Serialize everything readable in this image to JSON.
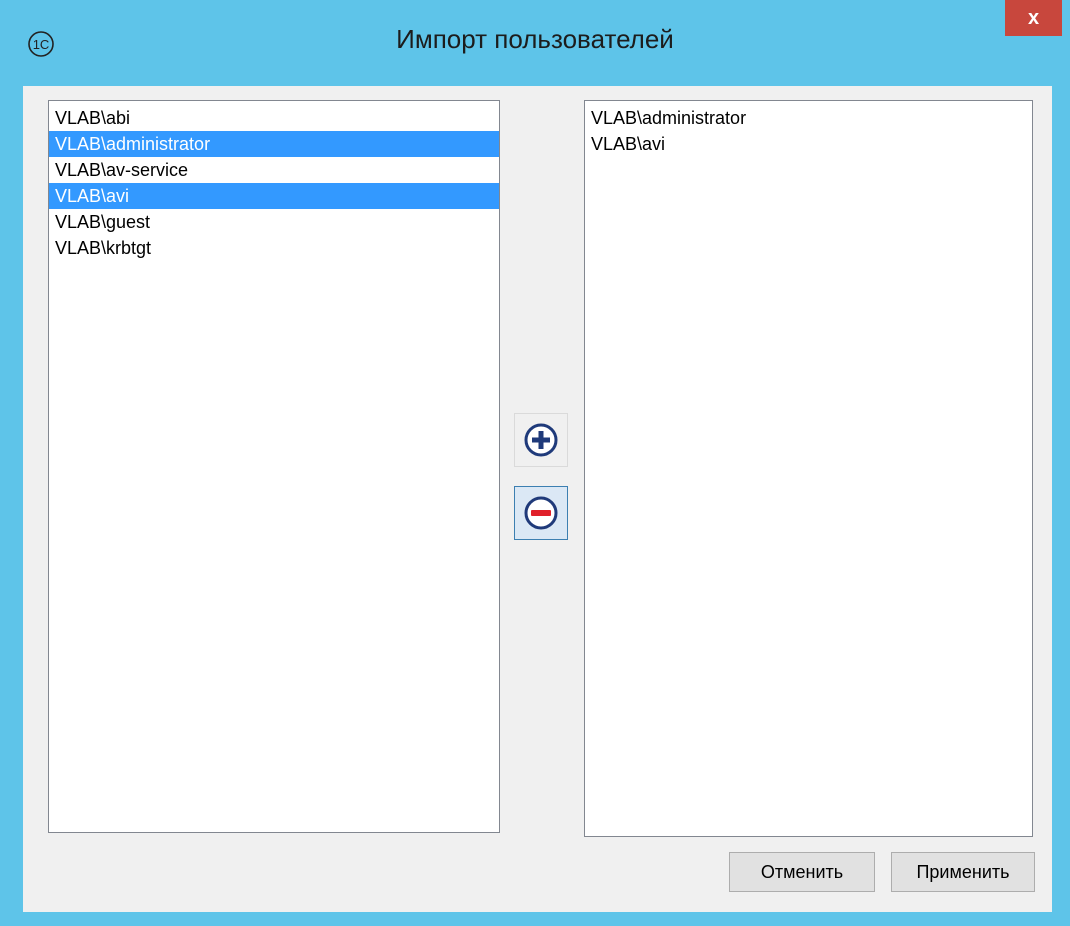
{
  "window": {
    "title": "Импорт пользователей",
    "close_label": "x",
    "app_icon": "1c-logo-icon"
  },
  "source_list": {
    "items": [
      {
        "label": "VLAB\\abi",
        "selected": false
      },
      {
        "label": "VLAB\\administrator",
        "selected": true
      },
      {
        "label": "VLAB\\av-service",
        "selected": false
      },
      {
        "label": "VLAB\\avi",
        "selected": true
      },
      {
        "label": "VLAB\\guest",
        "selected": false
      },
      {
        "label": "VLAB\\krbtgt",
        "selected": false
      }
    ]
  },
  "target_list": {
    "items": [
      {
        "label": "VLAB\\administrator"
      },
      {
        "label": "VLAB\\avi"
      }
    ]
  },
  "controls": {
    "add_icon": "plus-circle-icon",
    "remove_icon": "minus-circle-icon"
  },
  "buttons": {
    "cancel_label": "Отменить",
    "apply_label": "Применить"
  },
  "colors": {
    "titlebar": "#5ec4e9",
    "close_button": "#c8473d",
    "selection": "#3399ff",
    "add_icon": "#1f3a7a",
    "remove_icon": "#e0202a"
  }
}
